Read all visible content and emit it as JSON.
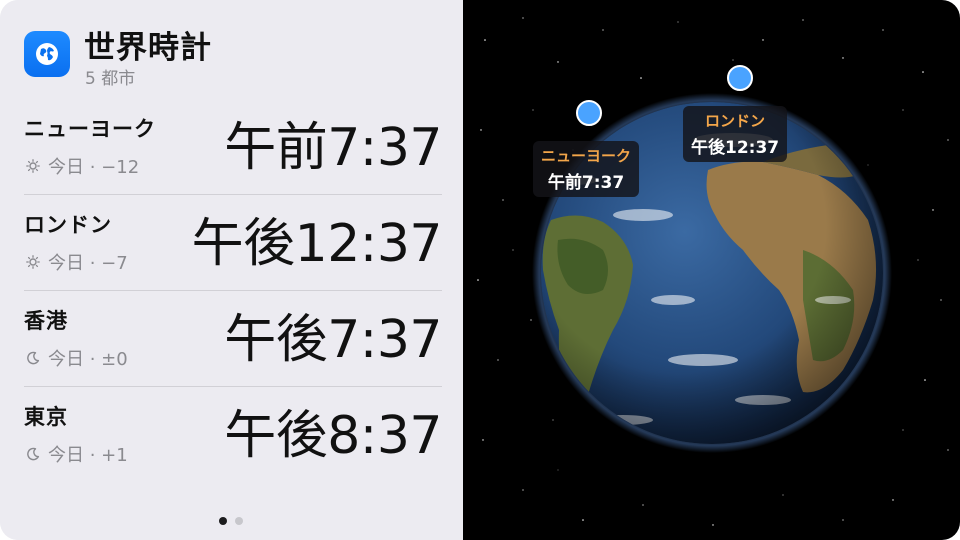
{
  "app": {
    "title": "世界時計",
    "subtitle": "5 都市",
    "icon": "globe-icon",
    "accent": "#0a7cff"
  },
  "clocks": [
    {
      "city": "ニューヨーク",
      "day_icon": "sun-icon",
      "offset": "今日 · −12",
      "time": "午前7:37"
    },
    {
      "city": "ロンドン",
      "day_icon": "sun-icon",
      "offset": "今日 · −7",
      "time": "午後12:37"
    },
    {
      "city": "香港",
      "day_icon": "moon-icon",
      "offset": "今日 · ±0",
      "time": "午後7:37"
    },
    {
      "city": "東京",
      "day_icon": "moon-icon",
      "offset": "今日 · +1",
      "time": "午後8:37"
    }
  ],
  "pagination": {
    "pages": 2,
    "current": 1
  },
  "globe": {
    "pins": [
      {
        "city": "ニューヨーク",
        "time": "午前7:37"
      },
      {
        "city": "ロンドン",
        "time": "午後12:37"
      }
    ],
    "label_city_color": "#f3a64a",
    "pin_color": "#4aa3ff"
  }
}
